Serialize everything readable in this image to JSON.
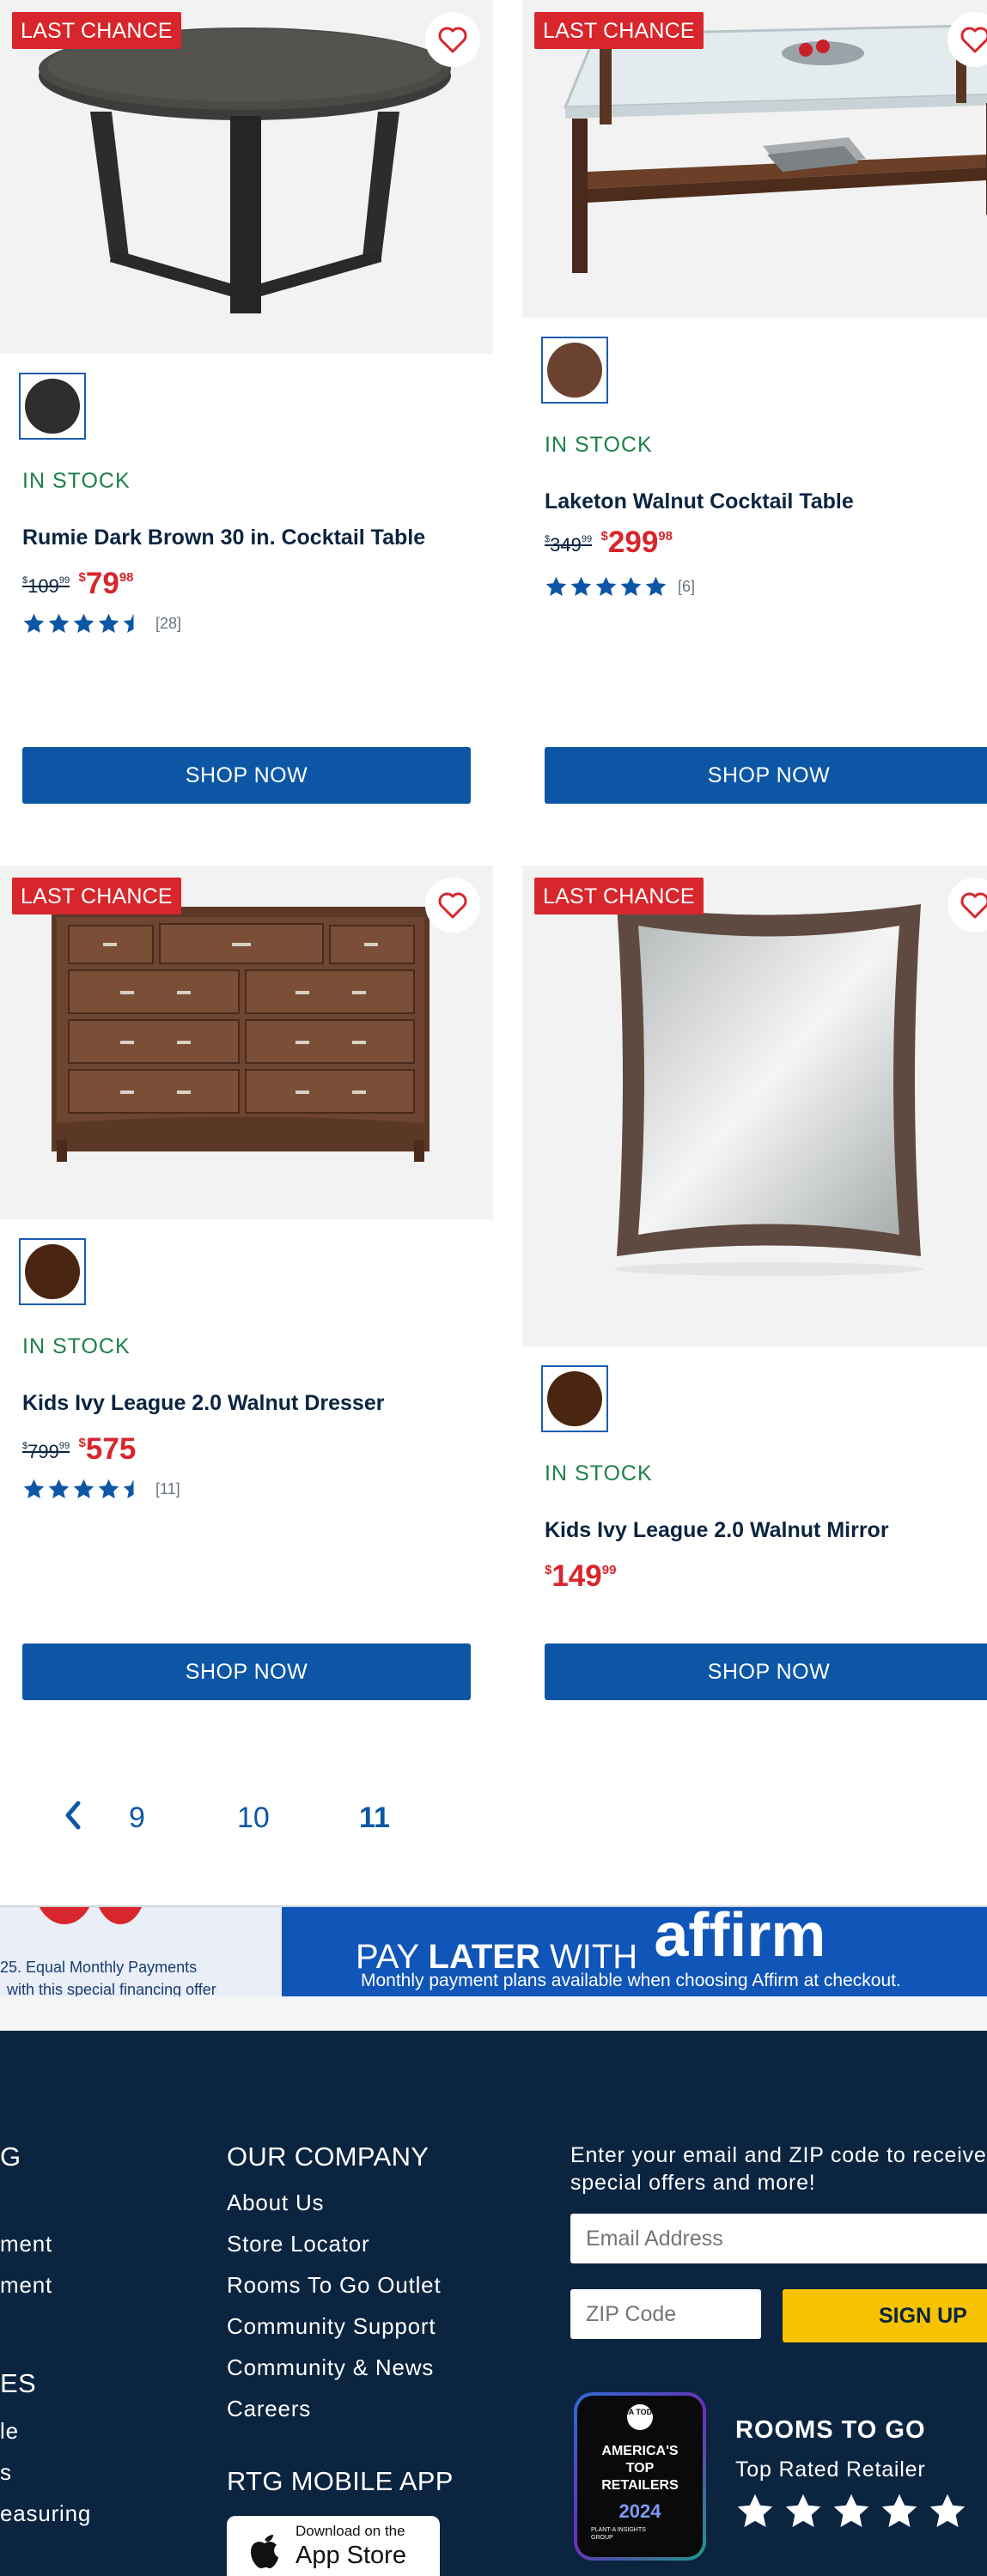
{
  "products": [
    {
      "badge": "LAST CHANCE",
      "stock": "IN STOCK",
      "title": "Rumie Dark Brown 30 in. Cocktail Table",
      "orig_price": "109",
      "orig_cents": "99",
      "sale_price": "79",
      "sale_cents": "98",
      "rating": 4.5,
      "review_count": "[28]",
      "swatch_color": "#2e2e2e",
      "button": "SHOP NOW"
    },
    {
      "badge": "LAST CHANCE",
      "stock": "IN STOCK",
      "title": "Laketon Walnut Cocktail Table",
      "orig_price": "349",
      "orig_cents": "99",
      "sale_price": "299",
      "sale_cents": "98",
      "rating": 5,
      "review_count": "[6]",
      "swatch_color": "#6b4130",
      "button": "SHOP NOW"
    },
    {
      "badge": "LAST CHANCE",
      "stock": "IN STOCK",
      "title": "Kids Ivy League 2.0 Walnut Dresser",
      "orig_price": "799",
      "orig_cents": "99",
      "sale_price": "575",
      "sale_cents": "",
      "rating": 4.5,
      "review_count": "[11]",
      "swatch_color": "#4a2612",
      "button": "SHOP NOW"
    },
    {
      "badge": "LAST CHANCE",
      "stock": "IN STOCK",
      "title": "Kids Ivy League 2.0 Walnut Mirror",
      "orig_price": "",
      "orig_cents": "",
      "sale_price": "149",
      "sale_cents": "99",
      "rating": null,
      "review_count": "",
      "swatch_color": "#4a2612",
      "button": "SHOP NOW"
    }
  ],
  "currency_symbol": "$",
  "pagination": {
    "prev_icon": "chevron-left-icon",
    "pages": [
      "9",
      "10",
      "11"
    ],
    "current": "11"
  },
  "banner": {
    "left_text_1": "25. Equal Monthly Payments",
    "left_text_2": "with this special financing offer",
    "headline_light": "PAY",
    "headline_bold": "LATER",
    "headline_with": "WITH",
    "brand": "affirm",
    "subtext": "Monthly payment plans available when choosing Affirm at checkout."
  },
  "footer": {
    "col1": {
      "heading": "G",
      "links": [
        "ment",
        "ment"
      ],
      "heading2": "ES",
      "links2": [
        "le",
        "s",
        "easuring"
      ]
    },
    "company": {
      "heading": "OUR COMPANY",
      "links": [
        "About Us",
        "Store Locator",
        "Rooms To Go Outlet",
        "Community Support",
        "Community & News",
        "Careers"
      ]
    },
    "app": {
      "heading": "RTG MOBILE APP",
      "store_small": "Download on the",
      "store_big": "App Store"
    },
    "newsletter": {
      "text": "Enter your email and ZIP code to receive special offers and more!",
      "email_placeholder": "Email Address",
      "zip_placeholder": "ZIP Code",
      "signup": "SIGN UP"
    },
    "award": {
      "top": "USA TODAY",
      "line1": "AMERICA'S",
      "line2": "TOP",
      "line3": "RETAILERS",
      "year": "2024",
      "bottom": "PLANT-A INSIGHTS GROUP",
      "brand": "ROOMS TO GO",
      "subtitle": "Top Rated Retailer",
      "stars": 5
    }
  },
  "colors": {
    "badge": "#d7262c",
    "sale": "#d7262c",
    "stock": "#1c7f4b",
    "button": "#0d56a6",
    "footer": "#0b2440",
    "signup": "#f7c300"
  }
}
